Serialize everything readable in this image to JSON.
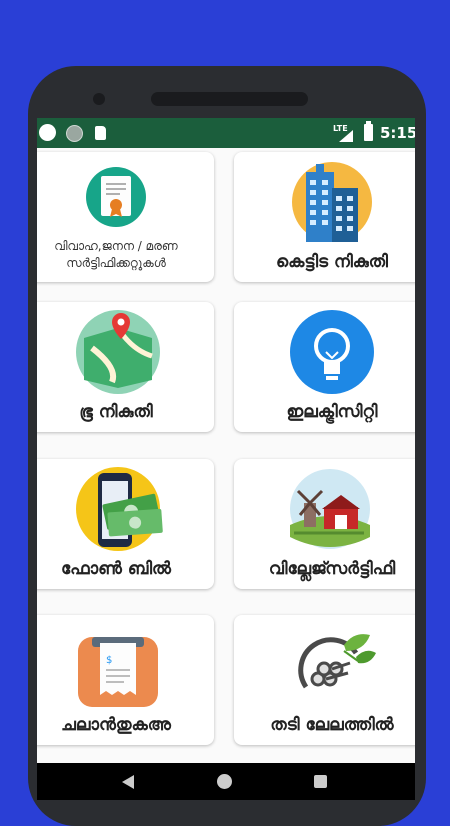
{
  "status_bar": {
    "network_type": "LTE",
    "time": "5:15"
  },
  "grid": {
    "items": [
      {
        "label": "വിവാഹ,ജനന / മരണ\nസർട്ടിഫിക്കറ്റുകൾ",
        "icon": "certificate-icon"
      },
      {
        "label": "കെട്ടിട നികുതി",
        "icon": "building-icon"
      },
      {
        "label": "ഭൂ നികുതി",
        "icon": "map-location-icon"
      },
      {
        "label": "ഇലക്ട്രിസിറ്റി",
        "icon": "lightbulb-icon"
      },
      {
        "label": "ഫോൺ ബിൽ",
        "icon": "phone-money-icon"
      },
      {
        "label": "വില്ലേജ്സർട്ടിഫി",
        "icon": "village-farm-icon"
      },
      {
        "label": "ചലാൻതുകഅ",
        "icon": "receipt-printer-icon"
      },
      {
        "label": "തടി ലേലത്തിൽ",
        "icon": "timber-logs-icon"
      }
    ]
  },
  "colors": {
    "background": "#2a3fd6",
    "status_bar": "#1b5e3c",
    "card": "#ffffff"
  }
}
